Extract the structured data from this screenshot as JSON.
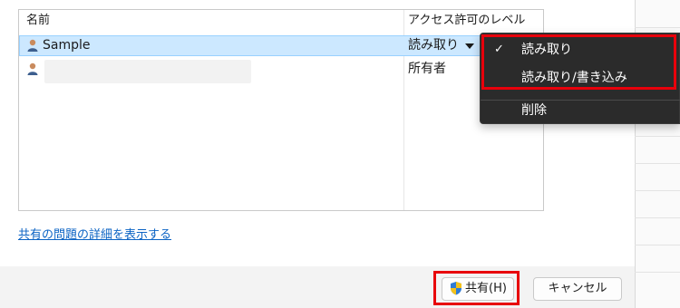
{
  "table": {
    "col_name": "名前",
    "col_access": "アクセス許可のレベル",
    "rows": [
      {
        "name": "Sample",
        "access": "読み取り"
      },
      {
        "name": "",
        "access": "所有者"
      }
    ]
  },
  "menu": {
    "items": [
      {
        "label": "読み取り",
        "checked": true,
        "check_glyph": "✓"
      },
      {
        "label": "読み取り/書き込み",
        "checked": false
      },
      {
        "label": "削除",
        "checked": false
      }
    ]
  },
  "link": {
    "text": "共有の問題の詳細を表示する"
  },
  "buttons": {
    "share": "共有(H)",
    "cancel": "キャンセル"
  },
  "colors": {
    "highlight": "#e8000b",
    "selected_row": "#cce8ff",
    "menu_bg": "#2b2b2b",
    "link": "#0b63c4"
  },
  "icons": {
    "user": "user-icon",
    "uac_shield": "uac-shield-icon",
    "dropdown": "dropdown-arrow-icon",
    "check": "checkmark-icon"
  }
}
